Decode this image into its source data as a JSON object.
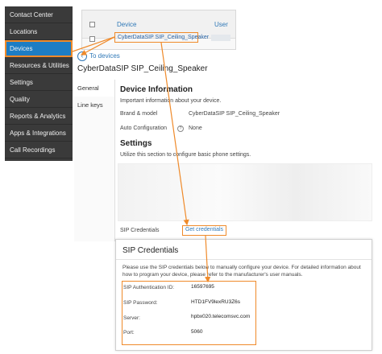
{
  "nav": {
    "items": [
      {
        "label": "Contact Center",
        "active": false
      },
      {
        "label": "Locations",
        "active": false
      },
      {
        "label": "Devices",
        "active": true
      },
      {
        "label": "Resources & Utilities",
        "active": false
      },
      {
        "label": "Settings",
        "active": false
      },
      {
        "label": "Quality",
        "active": false
      },
      {
        "label": "Reports & Analytics",
        "active": false
      },
      {
        "label": "Apps & Integrations",
        "active": false
      },
      {
        "label": "Call Recordings",
        "active": false
      }
    ]
  },
  "table": {
    "col_device": "Device",
    "col_user": "User",
    "row_device": "CyberDataSIP SIP_Ceiling_Speaker"
  },
  "back_link": "To devices",
  "device_title": "CyberDataSIP SIP_Ceiling_Speaker",
  "tabs": [
    "General",
    "Line keys"
  ],
  "device_info": {
    "heading": "Device Information",
    "description": "Important information about your device.",
    "brand_label": "Brand & model",
    "brand_value": "CyberDataSIP SIP_Ceiling_Speaker",
    "autoconf_label": "Auto Configuration",
    "autoconf_value": "None"
  },
  "settings": {
    "heading": "Settings",
    "description": "Utilize this section to configure basic phone settings.",
    "sip_label": "SIP Credentials",
    "get_credentials": "Get credentials"
  },
  "dialog": {
    "title": "SIP Credentials",
    "description": "Please use the SIP credentials below to manually configure your device. For detailed information about how to program your device, please refer to the manufacturer's user manuals.",
    "fields": [
      {
        "label": "SIP Authentication ID:",
        "value": "16597695"
      },
      {
        "label": "SIP Password:",
        "value": "HTD1FV9lexRU3Z6s"
      },
      {
        "label": "Server:",
        "value": "hpbx020.telecomsvc.com"
      },
      {
        "label": "Port:",
        "value": "5060"
      }
    ]
  },
  "colors": {
    "accent": "#1d7dc4",
    "highlight": "#ef8a2a",
    "nav_bg": "#3a3a3a"
  }
}
